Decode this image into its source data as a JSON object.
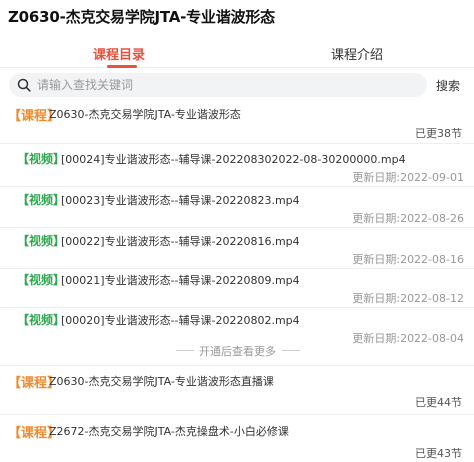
{
  "page": {
    "title": "Z0630-杰克交易学院JTA-专业谐波形态"
  },
  "tabs": [
    {
      "label": "课程目录",
      "active": true
    },
    {
      "label": "课程介绍",
      "active": false
    }
  ],
  "search": {
    "placeholder": "请输入查找关键词",
    "value": "",
    "button_label": "搜索",
    "icon": "search-icon"
  },
  "course_tag": "【课程】",
  "video_tag": "【视频】",
  "courses": [
    {
      "name": "Z0630-杰克交易学院JTA-专业谐波形态",
      "count": "已更38节"
    },
    {
      "name": "Z0630-杰克交易学院JTA-专业谐波形态直播课",
      "count": "已更44节"
    },
    {
      "name": "Z2672-杰克交易学院JTA-杰克操盘术-小白必修课",
      "count": "已更43节"
    }
  ],
  "videos": [
    {
      "name": "[00024]专业谐波形态--辅导课-202208302022-08-30200000.mp4",
      "date": "更新日期:2022-09-01"
    },
    {
      "name": "[00023]专业谐波形态--辅导课-20220823.mp4",
      "date": "更新日期:2022-08-26"
    },
    {
      "name": "[00022]专业谐波形态--辅导课-20220816.mp4",
      "date": "更新日期:2022-08-16"
    },
    {
      "name": "[00021]专业谐波形态--辅导课-20220809.mp4",
      "date": "更新日期:2022-08-12"
    },
    {
      "name": "[00020]专业谐波形态--辅导课-20220802.mp4",
      "date": "更新日期:2022-08-04"
    }
  ],
  "expand_more": "开通后查看更多",
  "colors": {
    "accent": "#e8513a",
    "course_tag": "#f08a2c",
    "video_tag": "#2fa84f"
  }
}
